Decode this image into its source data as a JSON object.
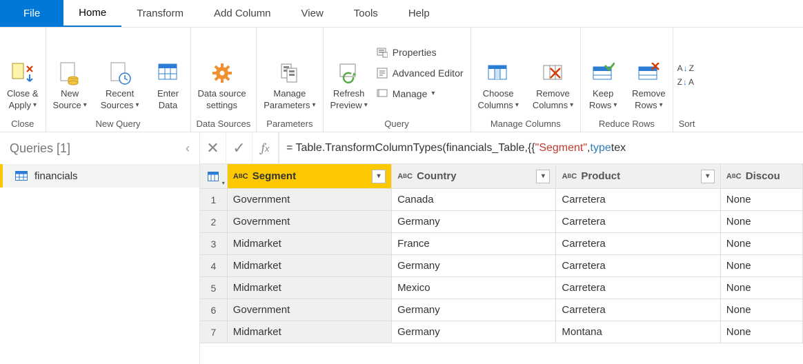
{
  "tabs": {
    "file": "File",
    "items": [
      "Home",
      "Transform",
      "Add Column",
      "View",
      "Tools",
      "Help"
    ],
    "active_index": 0
  },
  "ribbon": {
    "close_apply_l1": "Close &",
    "close_apply_l2": "Apply",
    "close_group": "Close",
    "new_source_l1": "New",
    "new_source_l2": "Source",
    "recent_sources_l1": "Recent",
    "recent_sources_l2": "Sources",
    "enter_data_l1": "Enter",
    "enter_data_l2": "Data",
    "new_query_group": "New Query",
    "data_source_l1": "Data source",
    "data_source_l2": "settings",
    "data_sources_group": "Data Sources",
    "manage_params_l1": "Manage",
    "manage_params_l2": "Parameters",
    "parameters_group": "Parameters",
    "refresh_l1": "Refresh",
    "refresh_l2": "Preview",
    "props": "Properties",
    "adv_editor": "Advanced Editor",
    "manage": "Manage",
    "query_group": "Query",
    "choose_cols_l1": "Choose",
    "choose_cols_l2": "Columns",
    "remove_cols_l1": "Remove",
    "remove_cols_l2": "Columns",
    "manage_cols_group": "Manage Columns",
    "keep_rows_l1": "Keep",
    "keep_rows_l2": "Rows",
    "remove_rows_l1": "Remove",
    "remove_rows_l2": "Rows",
    "reduce_rows_group": "Reduce Rows",
    "sort_group": "Sort",
    "sort_az_a": "A",
    "sort_az_z": "Z",
    "sort_za_z": "Z",
    "sort_za_a": "A"
  },
  "queries_pane": {
    "header": "Queries [1]",
    "items": [
      "financials"
    ]
  },
  "formula": {
    "prefix": "= Table.TransformColumnTypes(financials_Table,{{",
    "str": "\"Segment\"",
    "mid": ", ",
    "kw": "type",
    "tail": " tex"
  },
  "columns": [
    {
      "name": "Segment",
      "selected": true
    },
    {
      "name": "Country",
      "selected": false
    },
    {
      "name": "Product",
      "selected": false
    },
    {
      "name": "Discou",
      "selected": false
    }
  ],
  "type_label": "AᴮC",
  "rows": [
    {
      "n": 1,
      "Segment": "Government",
      "Country": "Canada",
      "Product": "Carretera",
      "Discou": "None"
    },
    {
      "n": 2,
      "Segment": "Government",
      "Country": "Germany",
      "Product": "Carretera",
      "Discou": "None"
    },
    {
      "n": 3,
      "Segment": "Midmarket",
      "Country": "France",
      "Product": "Carretera",
      "Discou": "None"
    },
    {
      "n": 4,
      "Segment": "Midmarket",
      "Country": "Germany",
      "Product": "Carretera",
      "Discou": "None"
    },
    {
      "n": 5,
      "Segment": "Midmarket",
      "Country": "Mexico",
      "Product": "Carretera",
      "Discou": "None"
    },
    {
      "n": 6,
      "Segment": "Government",
      "Country": "Germany",
      "Product": "Carretera",
      "Discou": "None"
    },
    {
      "n": 7,
      "Segment": "Midmarket",
      "Country": "Germany",
      "Product": "Montana",
      "Discou": "None"
    }
  ]
}
